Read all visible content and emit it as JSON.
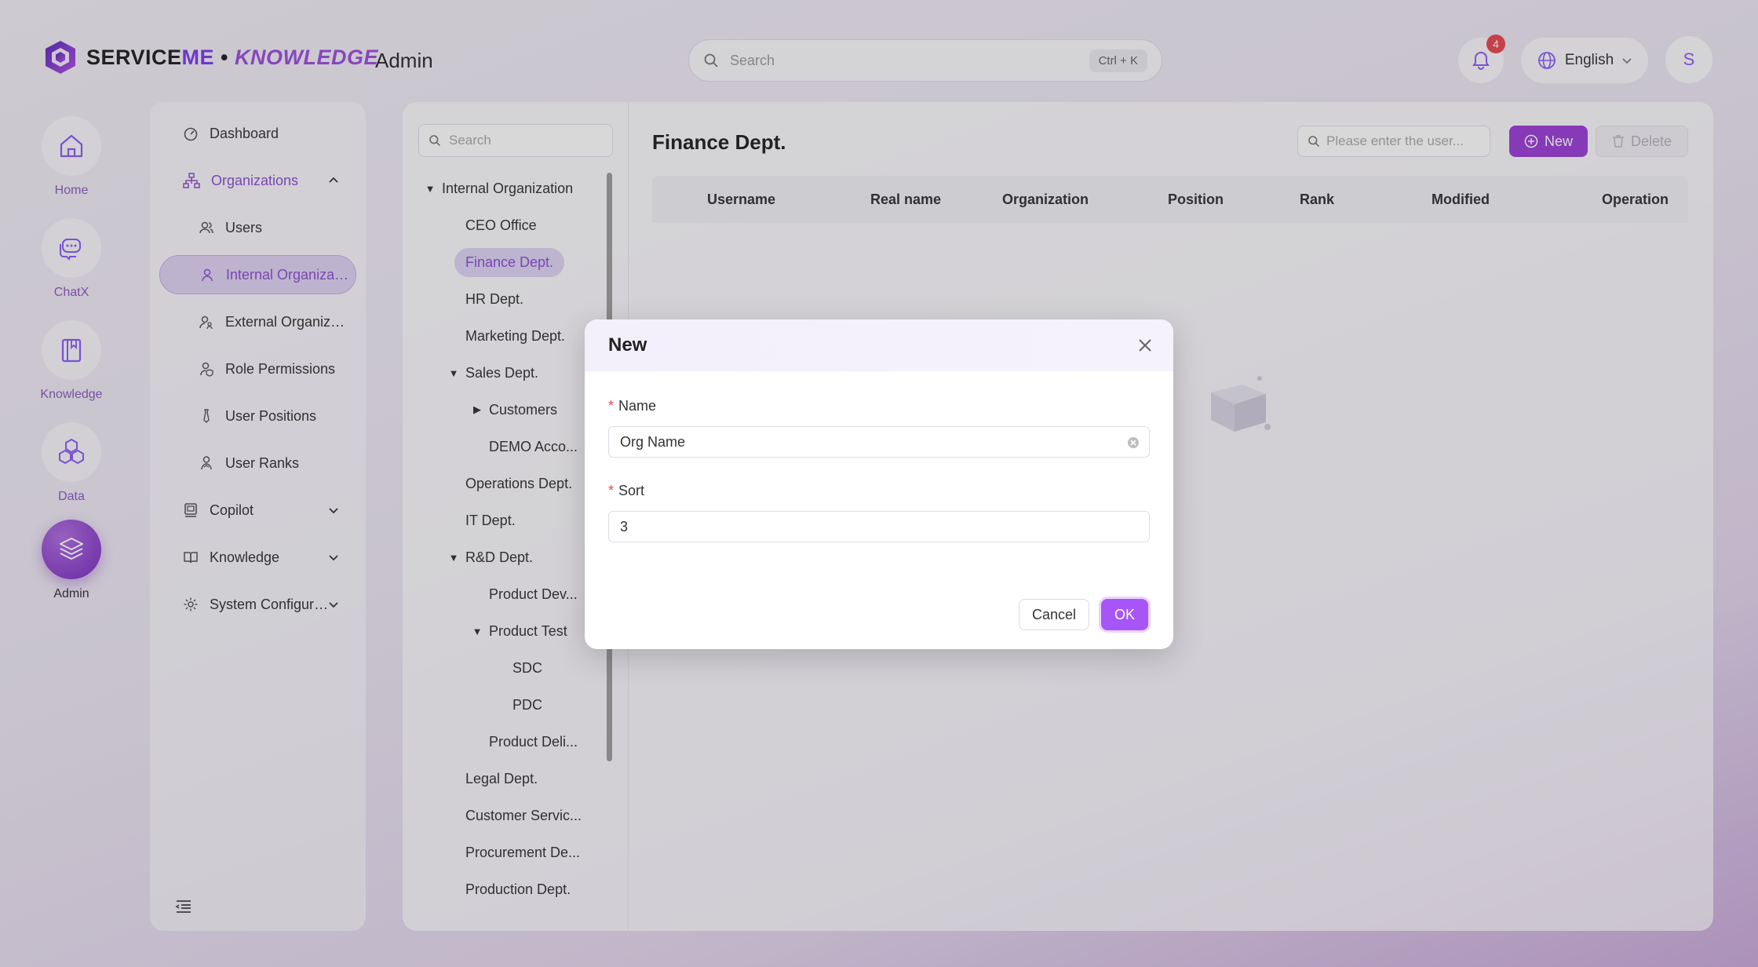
{
  "brand": {
    "part1": "SERVICE",
    "part2": "ME",
    "sep": " • ",
    "part3": "KNOWLEDGE",
    "section": "Admin"
  },
  "topbar": {
    "search_placeholder": "Search",
    "shortcut": "Ctrl + K",
    "notification_count": "4",
    "language": "English",
    "avatar_initial": "S"
  },
  "rail": [
    {
      "label": "Home",
      "icon": "home-icon"
    },
    {
      "label": "ChatX",
      "icon": "chat-icon"
    },
    {
      "label": "Knowledge",
      "icon": "book-icon"
    },
    {
      "label": "Data",
      "icon": "hexagons-icon"
    },
    {
      "label": "Admin",
      "icon": "layers-icon"
    }
  ],
  "menu": {
    "dashboard": "Dashboard",
    "organizations": "Organizations",
    "users": "Users",
    "internal": "Internal Organizati...",
    "external": "External Organizati...",
    "role_permissions": "Role Permissions",
    "user_positions": "User Positions",
    "user_ranks": "User Ranks",
    "copilot": "Copilot",
    "knowledge": "Knowledge",
    "system_config": "System Configurati..."
  },
  "tree": {
    "search_placeholder": "Search",
    "nodes": [
      {
        "label": "Internal Organization"
      },
      {
        "label": "CEO Office"
      },
      {
        "label": "Finance Dept."
      },
      {
        "label": "HR Dept."
      },
      {
        "label": "Marketing Dept."
      },
      {
        "label": "Sales Dept."
      },
      {
        "label": "Customers"
      },
      {
        "label": "DEMO Acco..."
      },
      {
        "label": "Operations Dept."
      },
      {
        "label": "IT Dept."
      },
      {
        "label": "R&D Dept."
      },
      {
        "label": "Product Dev..."
      },
      {
        "label": "Product Test"
      },
      {
        "label": "SDC"
      },
      {
        "label": "PDC"
      },
      {
        "label": "Product Deli..."
      },
      {
        "label": "Legal Dept."
      },
      {
        "label": "Customer Servic..."
      },
      {
        "label": "Procurement De..."
      },
      {
        "label": "Production Dept."
      }
    ]
  },
  "main": {
    "title": "Finance Dept.",
    "user_search_placeholder": "Please enter the user...",
    "new_label": "New",
    "delete_label": "Delete",
    "columns": [
      "Username",
      "Real name",
      "Organization",
      "Position",
      "Rank",
      "Modified",
      "Operation"
    ]
  },
  "modal": {
    "title": "New",
    "name_label": "Name",
    "name_value": "Org Name",
    "sort_label": "Sort",
    "sort_value": "3",
    "cancel_label": "Cancel",
    "ok_label": "OK"
  }
}
